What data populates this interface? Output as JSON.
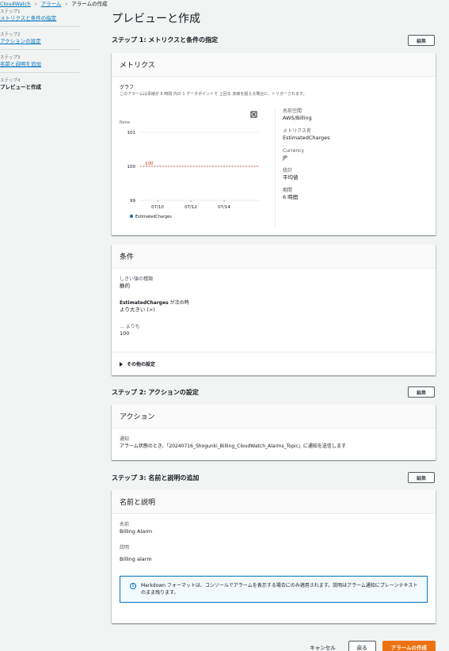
{
  "breadcrumb": {
    "root": "CloudWatch",
    "alarms": "アラーム",
    "current": "アラームの作成"
  },
  "nav": {
    "steps": [
      {
        "label": "ステップ1",
        "title": "メトリクスと条件の指定"
      },
      {
        "label": "ステップ2",
        "title": "アクションの設定"
      },
      {
        "label": "ステップ3",
        "title": "名前と説明を追加"
      },
      {
        "label": "ステップ4",
        "title": "プレビューと作成"
      }
    ]
  },
  "page_title": "プレビューと作成",
  "edit_label": "編集",
  "step1": {
    "heading": "ステップ 1: メトリクスと条件の指定",
    "metrics_title": "メトリクス",
    "graph_label": "グラフ",
    "graph_desc": "このアラームは青線が 6 時間 内の 1 データポイントで 上回る 赤線を超える場合に、トリガーされます。",
    "details": [
      {
        "label": "名前空間",
        "value": "AWS/Billing"
      },
      {
        "label": "メトリクス名",
        "value": "EstimatedCharges"
      },
      {
        "label": "Currency",
        "value": "JP"
      },
      {
        "label": "統計",
        "value": "平均値"
      },
      {
        "label": "期間",
        "value": "6 時間"
      }
    ],
    "conditions_title": "条件",
    "threshold_type_label": "しきい値の種類",
    "threshold_type_value": "静的",
    "when_metric": "EstimatedCharges",
    "when_suffix": " が次の時",
    "when_value": "より大きい (>)",
    "than_label": "… よりも",
    "than_value": "100",
    "other_settings": "その他の設定"
  },
  "step2": {
    "heading": "ステップ 2: アクションの設定",
    "actions_title": "アクション",
    "notify_label": "通知",
    "notify_value": "アラーム状態のとき、「20240716_Shogunki_Billing_CloudWatch_Alarms_Topic」に通知を送信します"
  },
  "step3": {
    "heading": "ステップ 3: 名前と説明の追加",
    "card_title": "名前と説明",
    "name_label": "名前",
    "name_value": "Billing Alarm",
    "desc_label": "説明",
    "desc_value": "Billing alarm",
    "info_text": "Markdown フォーマットは、コンソールでアラームを表示する場合にのみ適用されます。説明はアラーム通知にプレーンテキストのまま残ります。"
  },
  "footer": {
    "cancel": "キャンセル",
    "back": "戻る",
    "create": "アラームの作成"
  },
  "chart_data": {
    "type": "line",
    "unit_label": "None",
    "ylim": [
      99,
      101
    ],
    "yticks": [
      "101",
      "100",
      "99"
    ],
    "xticks": [
      "07/10",
      "07/12",
      "07/14"
    ],
    "threshold": {
      "value": 100,
      "label": "100",
      "color": "#d13212"
    },
    "series": [
      {
        "name": "EstimatedCharges",
        "color": "#1f77b4",
        "values": []
      }
    ]
  },
  "colors": {
    "link": "#0073bb",
    "primary": "#ec7211",
    "threshold": "#d13212"
  }
}
